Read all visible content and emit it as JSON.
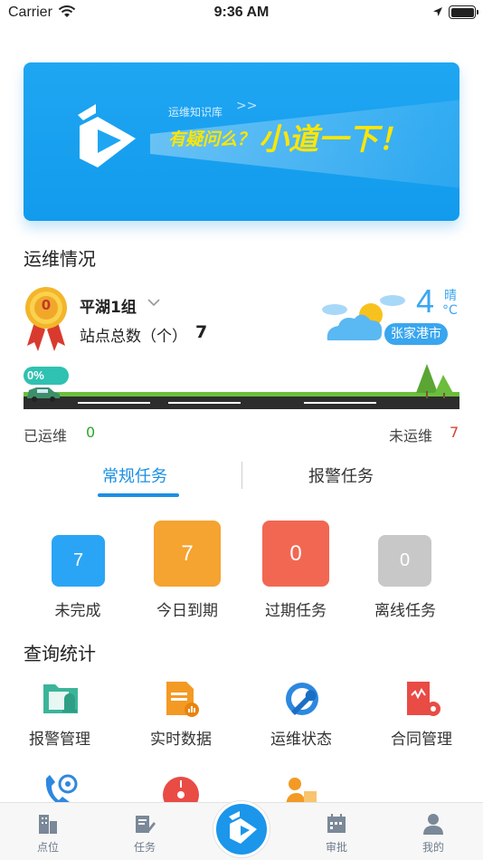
{
  "status_bar": {
    "carrier": "Carrier",
    "time": "9:36 AM"
  },
  "banner": {
    "subtitle": "运维知识库",
    "subtitle_arrows": ">>",
    "question": "有疑问么？",
    "headline": "小道一下！"
  },
  "ops": {
    "title": "运维情况",
    "medal_number": "0",
    "team_name": "平湖1组",
    "site_count_label": "站点总数（个）",
    "site_count": "7",
    "weather": {
      "temp": "4",
      "condition": "晴",
      "unit": "°C",
      "city": "张家港市"
    },
    "progress": {
      "label": "0%",
      "fraction": 0
    },
    "done_label": "已运维",
    "done_count": "0",
    "undone_label": "未运维",
    "undone_count": "7"
  },
  "tabs": {
    "active": "常规任务",
    "inactive": "报警任务"
  },
  "stats": [
    {
      "label": "未完成",
      "value": "7",
      "color": "#2aa5f5"
    },
    {
      "label": "今日到期",
      "value": "7",
      "color": "#f5a331"
    },
    {
      "label": "过期任务",
      "value": "0",
      "color": "#f26752"
    },
    {
      "label": "离线任务",
      "value": "0",
      "color": "#c8c8c8"
    }
  ],
  "query": {
    "title": "查询统计",
    "items": [
      {
        "label": "报警管理",
        "icon": "alarm-folder-icon"
      },
      {
        "label": "实时数据",
        "icon": "data-document-icon"
      },
      {
        "label": "运维状态",
        "icon": "wrench-icon"
      },
      {
        "label": "合同管理",
        "icon": "contract-icon"
      }
    ],
    "partial_icons": [
      "phone-icon",
      "gauge-icon",
      "worker-icon"
    ]
  },
  "tabbar": {
    "items": [
      {
        "label": "点位",
        "icon": "building-icon"
      },
      {
        "label": "任务",
        "icon": "task-edit-icon"
      },
      {
        "label": "审批",
        "icon": "calendar-icon"
      },
      {
        "label": "我的",
        "icon": "user-icon"
      }
    ],
    "center_icon": "home-logo-icon"
  }
}
